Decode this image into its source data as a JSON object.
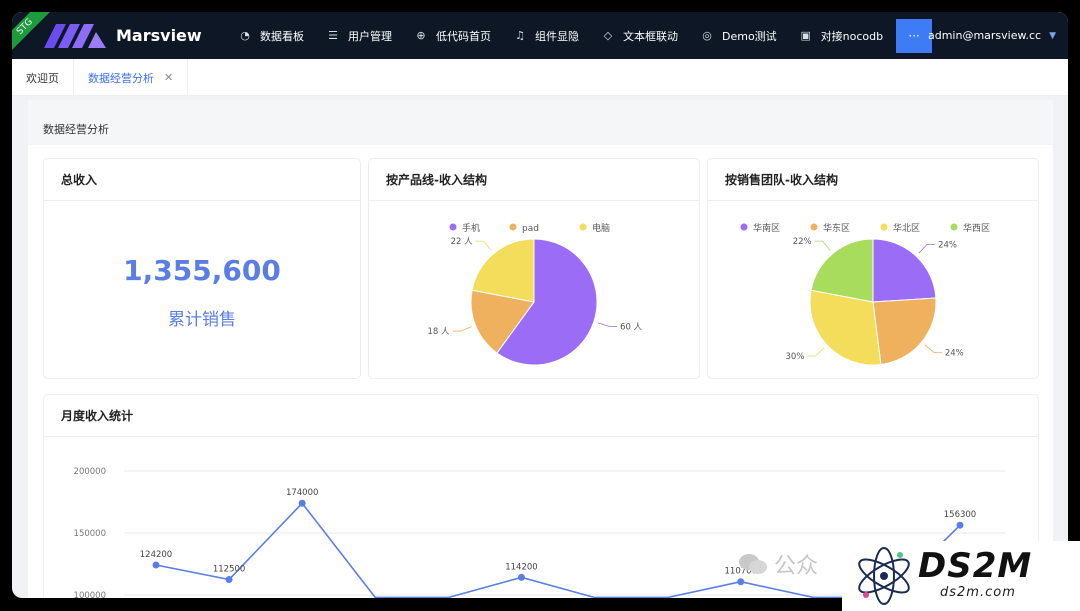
{
  "app": {
    "ribbon": "STG",
    "name": "Marsview",
    "user": "admin@marsview.cc",
    "more_label": "···"
  },
  "menu": [
    {
      "label": "数据看板",
      "icon": "dashboard-icon",
      "glyph": "◔"
    },
    {
      "label": "用户管理",
      "icon": "users-icon",
      "glyph": "☰"
    },
    {
      "label": "低代码首页",
      "icon": "target-icon",
      "glyph": "⊕"
    },
    {
      "label": "组件显隐",
      "icon": "bell-icon",
      "glyph": "♫"
    },
    {
      "label": "文本框联动",
      "icon": "tag-icon",
      "glyph": "◇"
    },
    {
      "label": "Demo测试",
      "icon": "chrome-icon",
      "glyph": "◎"
    },
    {
      "label": "对接nocodb",
      "icon": "calendar-icon",
      "glyph": "▣"
    }
  ],
  "tabs": [
    {
      "label": "欢迎页"
    },
    {
      "label": "数据经营分析",
      "close": "✕"
    }
  ],
  "page": {
    "title": "数据经营分析"
  },
  "cards": {
    "total": {
      "title": "总收入",
      "value": "1,355,600",
      "caption": "累计销售"
    },
    "product": {
      "title": "按产品线-收入结构"
    },
    "team": {
      "title": "按销售团队-收入结构"
    },
    "monthly": {
      "title": "月度收入统计"
    }
  },
  "colors": {
    "purple": "#9b6cf5",
    "orange": "#f0b15e",
    "yellow": "#f3dd5a",
    "green": "#a8dc5c",
    "line": "#5b7de6",
    "topbar": "#0d1726",
    "accent": "#3b6ff5"
  },
  "chart_data": [
    {
      "type": "pie",
      "legend": [
        "手机",
        "pad",
        "电脑"
      ],
      "series": [
        {
          "name": "手机",
          "value": 60,
          "label": "60 人",
          "color": "#9b6cf5"
        },
        {
          "name": "pad",
          "value": 18,
          "label": "18 人",
          "color": "#f0b15e"
        },
        {
          "name": "电脑",
          "value": 22,
          "label": "22 人",
          "color": "#f3dd5a"
        }
      ]
    },
    {
      "type": "pie",
      "legend": [
        "华南区",
        "华东区",
        "华北区",
        "华西区"
      ],
      "series": [
        {
          "name": "华南区",
          "value": 24,
          "label": "24%",
          "color": "#9b6cf5"
        },
        {
          "name": "华东区",
          "value": 24,
          "label": "24%",
          "color": "#f0b15e"
        },
        {
          "name": "华北区",
          "value": 30,
          "label": "30%",
          "color": "#f3dd5a"
        },
        {
          "name": "华西区",
          "value": 22,
          "label": "22%",
          "color": "#a8dc5c"
        }
      ]
    },
    {
      "type": "line",
      "y_ticks": [
        "200000",
        "150000",
        "100000"
      ],
      "ylim": [
        100000,
        200000
      ],
      "points": [
        {
          "idx": 0,
          "value": 124200,
          "label": "124200"
        },
        {
          "idx": 1,
          "value": 112500,
          "label": "112500"
        },
        {
          "idx": 2,
          "value": 174000,
          "label": "174000"
        },
        {
          "idx": 3,
          "value": 98000,
          "label": ""
        },
        {
          "idx": 4,
          "value": 98000,
          "label": ""
        },
        {
          "idx": 5,
          "value": 114200,
          "label": "114200"
        },
        {
          "idx": 6,
          "value": 98000,
          "label": ""
        },
        {
          "idx": 7,
          "value": 98000,
          "label": ""
        },
        {
          "idx": 8,
          "value": 110700,
          "label": "110700"
        },
        {
          "idx": 9,
          "value": 98000,
          "label": ""
        },
        {
          "idx": 10,
          "value": 98000,
          "label": ""
        },
        {
          "idx": 11,
          "value": 156300,
          "label": "156300"
        }
      ]
    }
  ],
  "watermark": {
    "text": "公众",
    "brand": "DS2M",
    "sub": "ds2m.com"
  }
}
